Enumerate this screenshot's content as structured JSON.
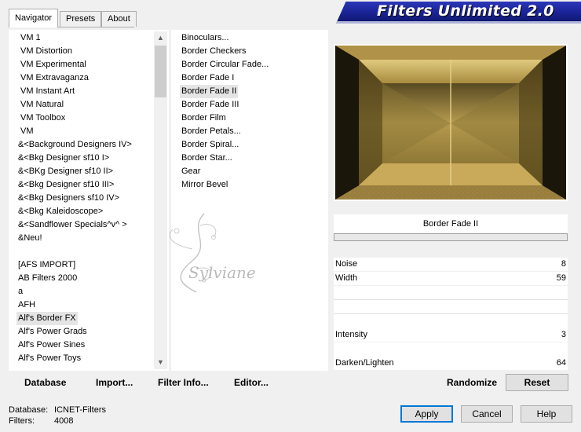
{
  "window": {
    "title": "Filters Unlimited 2.0"
  },
  "tabs": [
    {
      "label": "Navigator",
      "active": true
    },
    {
      "label": "Presets",
      "active": false
    },
    {
      "label": "About",
      "active": false
    }
  ],
  "categories": [
    "VM 1",
    "VM Distortion",
    "VM Experimental",
    "VM Extravaganza",
    "VM Instant Art",
    "VM Natural",
    "VM Toolbox",
    "VM",
    "&<Background Designers IV>",
    "&<Bkg Designer sf10 I>",
    "&<BKg Designer sf10 II>",
    "&<Bkg Designer sf10 III>",
    "&<Bkg Designers sf10 IV>",
    "&<Bkg Kaleidoscope>",
    "&<Sandflower Specials^v^ >",
    "&Neu!",
    "",
    "[AFS IMPORT]",
    "AB Filters 2000",
    "a",
    "AFH",
    "Alf's Border FX",
    "Alf's Power Grads",
    "Alf's Power Sines",
    "Alf's Power Toys"
  ],
  "selected_category_index": 21,
  "filters": [
    "Binoculars...",
    "Border Checkers",
    "Border Circular Fade...",
    "Border Fade I",
    "Border Fade II",
    "Border Fade III",
    "Border Film",
    "Border Petals...",
    "Border Spiral...",
    "Border Star...",
    "Gear",
    "Mirror Bevel"
  ],
  "selected_filter_index": 4,
  "watermark": "Sylviane",
  "toolbar": {
    "database": "Database",
    "import": "Import...",
    "filter_info": "Filter Info...",
    "editor": "Editor..."
  },
  "filter_name": "Border Fade II",
  "params": [
    {
      "label": "Noise",
      "value": "8"
    },
    {
      "label": "Width",
      "value": "59"
    },
    {
      "label": "Intensity",
      "value": "3"
    },
    {
      "label": "Darken/Lighten",
      "value": "64"
    }
  ],
  "buttons": {
    "randomize": "Randomize",
    "reset": "Reset",
    "apply": "Apply",
    "cancel": "Cancel",
    "help": "Help"
  },
  "status": {
    "database_label": "Database:",
    "database_value": "ICNET-Filters",
    "filters_label": "Filters:",
    "filters_value": "4008"
  },
  "colors": {
    "banner": "#1a2496",
    "preview_gold": "#c9aa5a",
    "accent": "#0078d7"
  }
}
